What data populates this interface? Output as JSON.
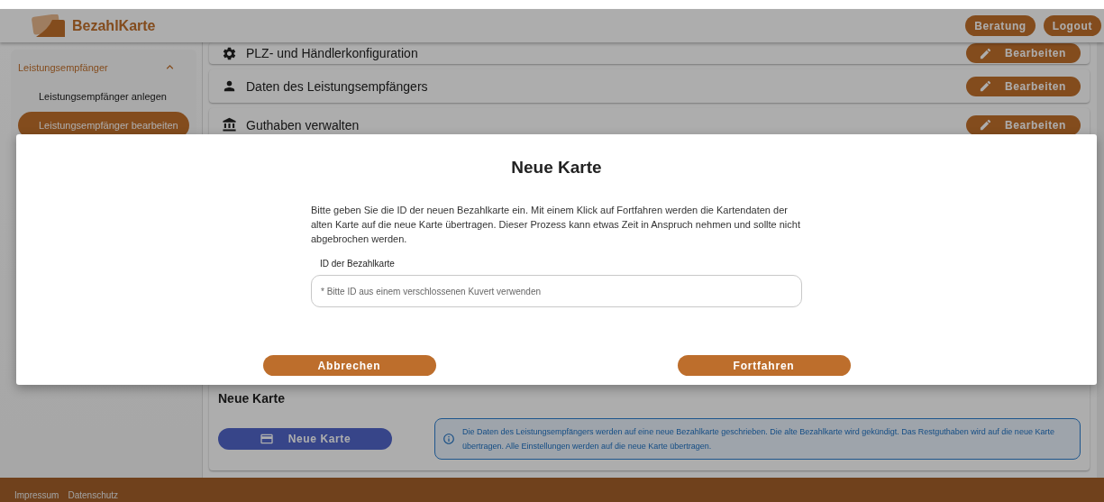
{
  "header": {
    "logo": "BezahlKarte",
    "buttons": [
      "Beratung",
      "Logout"
    ]
  },
  "sidebar": {
    "group": {
      "label": "Leistungsempfänger",
      "expanded": true,
      "items": [
        {
          "label": "Leistungsempfänger anlegen",
          "selected": false
        },
        {
          "label": "Leistungsempfänger bearbeiten",
          "selected": true
        }
      ]
    }
  },
  "sections": [
    {
      "kind": "config",
      "label": "PLZ- und Händlerkonfiguration",
      "action": "Bearbeiten"
    },
    {
      "kind": "person",
      "label": "Daten des Leistungsempfängers",
      "action": "Bearbeiten"
    },
    {
      "kind": "balance",
      "label": "Guthaben verwalten",
      "action": "Bearbeiten"
    }
  ],
  "new_card": {
    "heading": "Neue Karte",
    "button": "Neue Karte",
    "info": "Die Daten des Leistungsempfängers werden auf eine neue Bezahlkarte geschrieben. Die alte Bezahlkarte wird gekündigt. Das Restguthaben wird auf die neue Karte übertragen. Alle Einstellungen werden auf die neue Karte übertragen."
  },
  "dialog": {
    "title": "Neue Karte",
    "text": "Bitte geben Sie die ID der neuen Bezahlkarte ein. Mit einem Klick auf Fortfahren werden die Kartendaten der alten Karte auf die neue Karte übertragen. Dieser Prozess kann etwas Zeit in Anspruch nehmen und sollte nicht abgebrochen werden.",
    "field": {
      "label": "ID der Bezahlkarte",
      "placeholder": "* Bitte ID aus einem verschlossenen Kuvert verwenden"
    },
    "buttons": [
      "Abbrechen",
      "Fortfahren"
    ]
  },
  "footer": {
    "links": [
      "Impressum",
      "Datenschutz"
    ]
  }
}
